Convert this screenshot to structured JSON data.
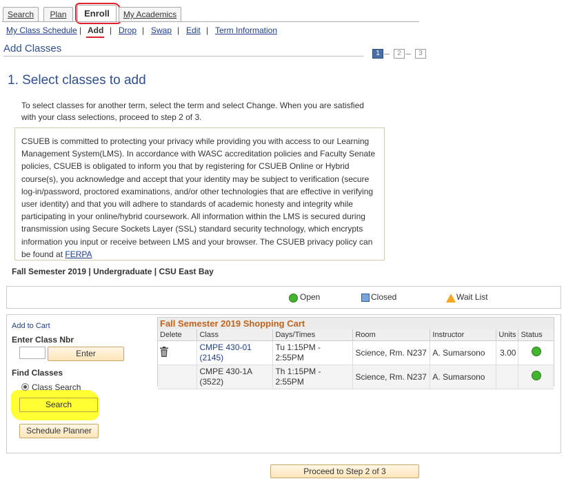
{
  "tabs": {
    "search": "Search",
    "plan": "Plan",
    "enroll": "Enroll",
    "my_academics": "My Academics"
  },
  "subnav": {
    "my_class_schedule": "My Class Schedule",
    "add": "Add",
    "drop": "Drop",
    "swap": "Swap",
    "edit": "Edit",
    "term_information": "Term Information",
    "separator": "|"
  },
  "page": {
    "section_title": "Add Classes",
    "steps": [
      "1",
      "2",
      "3"
    ],
    "heading": "1.  Select classes to add",
    "instructions": "To select classes for another term, select the term and select Change.  When you are satisfied with your class selections, proceed to step 2 of 3.",
    "privacy_text": "CSUEB is committed to protecting your privacy while providing you with access to our Learning Management System(LMS). In accordance with WASC accreditation policies and Faculty Senate policies, CSUEB is obligated to inform you that by registering for CSUEB Online or Hybrid course(s), you acknowledge and accept that your identity may be subject to verification (secure log-in/password, proctored examinations, and/or other technologies that are effective in verifying user identity) and that you will adhere to standards of academic honesty and integrity while participating in your online/hybrid coursework. All information within the LMS is secured during transmission using Secure Sockets Layer (SSL) standard security technology, which encrypts information you input or receive between LMS and your browser. The CSUEB privacy policy can be found at ",
    "privacy_link": "FERPA",
    "term_line": "Fall Semester 2019 | Undergraduate | CSU East Bay"
  },
  "legend": {
    "open": "Open",
    "closed": "Closed",
    "wait_list": "Wait List"
  },
  "left_panel": {
    "add_to_cart": "Add to Cart",
    "enter_class_nbr": "Enter Class Nbr",
    "enter_button": "Enter",
    "find_classes": "Find Classes",
    "class_search_radio": "Class Search",
    "search_button": "Search",
    "schedule_planner_button": "Schedule Planner"
  },
  "cart": {
    "title": "Fall Semester 2019 Shopping Cart",
    "columns": [
      "Delete",
      "Class",
      "Days/Times",
      "Room",
      "Instructor",
      "Units",
      "Status"
    ],
    "rows": [
      {
        "class_line1": "CMPE 430-01",
        "class_line2": "(2145)",
        "days_line1": "Tu 1:15PM -",
        "days_line2": "2:55PM",
        "room": "Science, Rm. N237",
        "instructor": "A. Sumarsono",
        "units": "3.00",
        "status": "Open",
        "has_delete": true
      },
      {
        "class_line1": "CMPE 430-1A",
        "class_line2": "(3522)",
        "days_line1": "Th 1:15PM -",
        "days_line2": "2:55PM",
        "room": "Science, Rm. N237",
        "instructor": "A. Sumarsono",
        "units": "",
        "status": "Open",
        "has_delete": false
      }
    ]
  },
  "footer": {
    "proceed_button": "Proceed to Step 2 of 3"
  },
  "colors": {
    "accent_title": "#2f4f8f",
    "link": "#1d3e8a",
    "cart_title": "#c1631d",
    "open_green": "#41b52b",
    "annotation_red": "#e0202a",
    "highlight_yellow": "#ffff33"
  }
}
